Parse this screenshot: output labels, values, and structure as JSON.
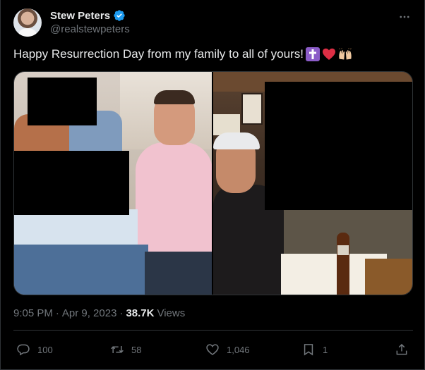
{
  "author": {
    "display_name": "Stew Peters",
    "handle": "@realstewpeters",
    "verified_icon": "verified-badge-icon"
  },
  "tweet": {
    "text": "Happy Resurrection Day from my family to all of yours!",
    "emojis": [
      "latin-cross-emoji",
      "red-heart-emoji",
      "raising-hands-emoji"
    ]
  },
  "media": {
    "photo_count": 2
  },
  "meta": {
    "time": "9:05 PM",
    "separator": "·",
    "date": "Apr 9, 2023",
    "views_count": "38.7K",
    "views_label": "Views"
  },
  "actions": {
    "replies": "100",
    "reposts": "58",
    "likes": "1,046",
    "bookmarks": "1"
  },
  "colors": {
    "background": "#000000",
    "text": "#e7e9ea",
    "secondary": "#71767b",
    "verified": "#1d9bf0",
    "border": "#2f3336"
  }
}
